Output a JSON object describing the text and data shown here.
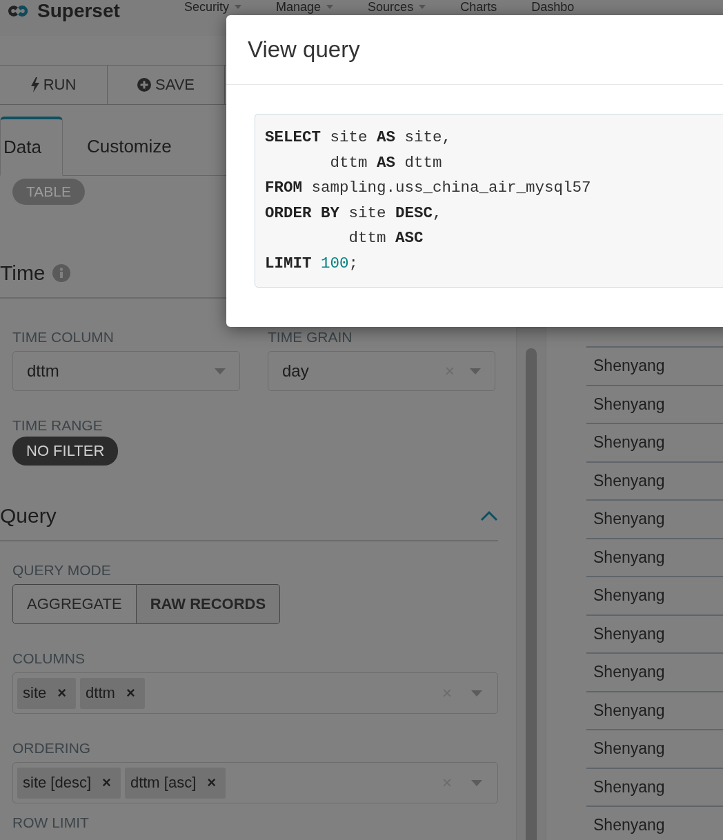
{
  "header": {
    "brand": "Superset",
    "nav": [
      {
        "label": "Security",
        "dropdown": true
      },
      {
        "label": "Manage",
        "dropdown": true
      },
      {
        "label": "Sources",
        "dropdown": true
      },
      {
        "label": "Charts",
        "dropdown": false
      },
      {
        "label": "Dashbo",
        "dropdown": false
      }
    ]
  },
  "toolbar": {
    "buttons": [
      {
        "label": "RUN",
        "kind": "run"
      },
      {
        "label": "SAVE",
        "kind": "save"
      }
    ]
  },
  "tabs": [
    {
      "label": "Data",
      "selected": true
    },
    {
      "label": "Customize",
      "selected": false
    }
  ],
  "datasource_type": "TABLE",
  "sections": [
    {
      "title": "Time",
      "info": true,
      "collapsible": false,
      "controls": [
        {
          "kind": "selects",
          "items": [
            {
              "label": "TIME COLUMN",
              "value": "dttm",
              "clearable": false
            },
            {
              "label": "TIME GRAIN",
              "value": "day",
              "clearable": true,
              "clear": "×"
            }
          ]
        },
        {
          "kind": "pill",
          "label": "TIME RANGE",
          "value": "NO FILTER"
        }
      ]
    },
    {
      "title": "Query",
      "info": false,
      "collapsible": true,
      "controls": [
        {
          "kind": "segmented",
          "label": "QUERY MODE",
          "options": [
            {
              "label": "AGGREGATE",
              "selected": false
            },
            {
              "label": "RAW RECORDS",
              "selected": true
            }
          ]
        },
        {
          "kind": "multi",
          "label": "COLUMNS",
          "clear": "×",
          "tags": [
            {
              "label": "site",
              "remove": "×"
            },
            {
              "label": "dttm",
              "remove": "×"
            }
          ]
        },
        {
          "kind": "multi",
          "label": "ORDERING",
          "clear": "×",
          "tags": [
            {
              "label": "site [desc]",
              "remove": "×"
            },
            {
              "label": "dttm [asc]",
              "remove": "×"
            }
          ]
        },
        {
          "kind": "label",
          "label": "ROW LIMIT"
        }
      ]
    }
  ],
  "results": {
    "rows": [
      "Shenyang",
      "Shenyang",
      "Shenyang",
      "Shenyang",
      "Shenyang",
      "Shenyang",
      "Shenyang",
      "Shenyang",
      "Shenyang",
      "Shenyang",
      "Shenyang",
      "Shenyang",
      "Shenyang"
    ]
  },
  "modal": {
    "title": "View query",
    "code": [
      [
        {
          "kind": "keyword",
          "text": "SELECT"
        },
        {
          "kind": "plain",
          "text": " site "
        },
        {
          "kind": "keyword",
          "text": "AS"
        },
        {
          "kind": "plain",
          "text": " site,"
        }
      ],
      [
        {
          "kind": "plain",
          "text": "       dttm "
        },
        {
          "kind": "keyword",
          "text": "AS"
        },
        {
          "kind": "plain",
          "text": " dttm"
        }
      ],
      [
        {
          "kind": "keyword",
          "text": "FROM"
        },
        {
          "kind": "plain",
          "text": " sampling.uss_china_air_mysql57"
        }
      ],
      [
        {
          "kind": "keyword",
          "text": "ORDER BY"
        },
        {
          "kind": "plain",
          "text": " site "
        },
        {
          "kind": "keyword",
          "text": "DESC"
        },
        {
          "kind": "plain",
          "text": ","
        }
      ],
      [
        {
          "kind": "plain",
          "text": "         dttm "
        },
        {
          "kind": "keyword",
          "text": "ASC"
        }
      ],
      [
        {
          "kind": "keyword",
          "text": "LIMIT"
        },
        {
          "kind": "number",
          "text": " 100"
        },
        {
          "kind": "plain",
          "text": ";"
        }
      ]
    ]
  }
}
